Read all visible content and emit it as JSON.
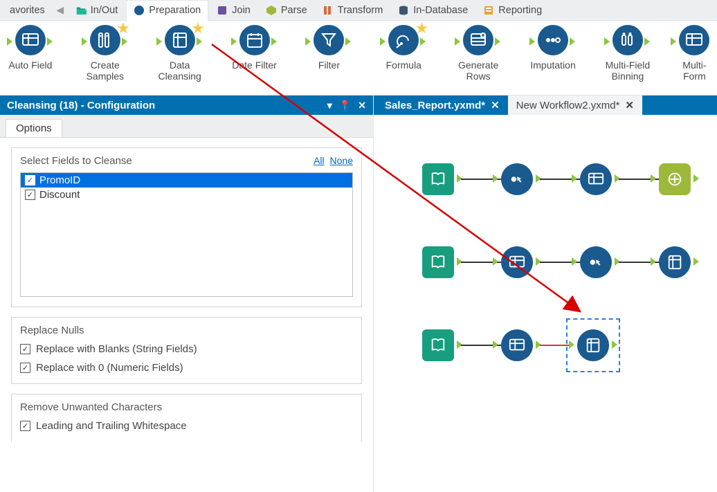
{
  "categories": {
    "favorites": "avorites",
    "in_out": "In/Out",
    "preparation": "Preparation",
    "join": "Join",
    "parse": "Parse",
    "transform": "Transform",
    "in_database": "In-Database",
    "reporting": "Reporting"
  },
  "palette": {
    "auto_field": "Auto Field",
    "create_samples": "Create\nSamples",
    "data_cleansing": "Data\nCleansing",
    "date_filter": "Date Filter",
    "filter": "Filter",
    "formula": "Formula",
    "generate_rows": "Generate\nRows",
    "imputation": "Imputation",
    "multi_field_binning": "Multi-Field\nBinning",
    "multi_field_formula": "Multi-\nForm"
  },
  "config_title": "Cleansing (18) - Configuration",
  "config_title_icons": {
    "dropdown": "▾",
    "pin": "📌",
    "close": "✕"
  },
  "config_tab": "Options",
  "select_fields": {
    "heading": "Select Fields to Cleanse",
    "link_all": "All",
    "link_none": "None",
    "fields": [
      {
        "name": "PromoID",
        "checked": true,
        "selected": true
      },
      {
        "name": "Discount",
        "checked": true,
        "selected": false
      }
    ]
  },
  "replace_nulls": {
    "heading": "Replace Nulls",
    "opt_blanks": "Replace with Blanks (String Fields)",
    "opt_zero": "Replace with 0 (Numeric Fields)"
  },
  "remove_chars": {
    "heading": "Remove Unwanted Characters",
    "opt_trim": "Leading and Trailing Whitespace"
  },
  "workflow_tabs": {
    "active": "Sales_Report.yxmd*",
    "inactive": "New Workflow2.yxmd*"
  }
}
